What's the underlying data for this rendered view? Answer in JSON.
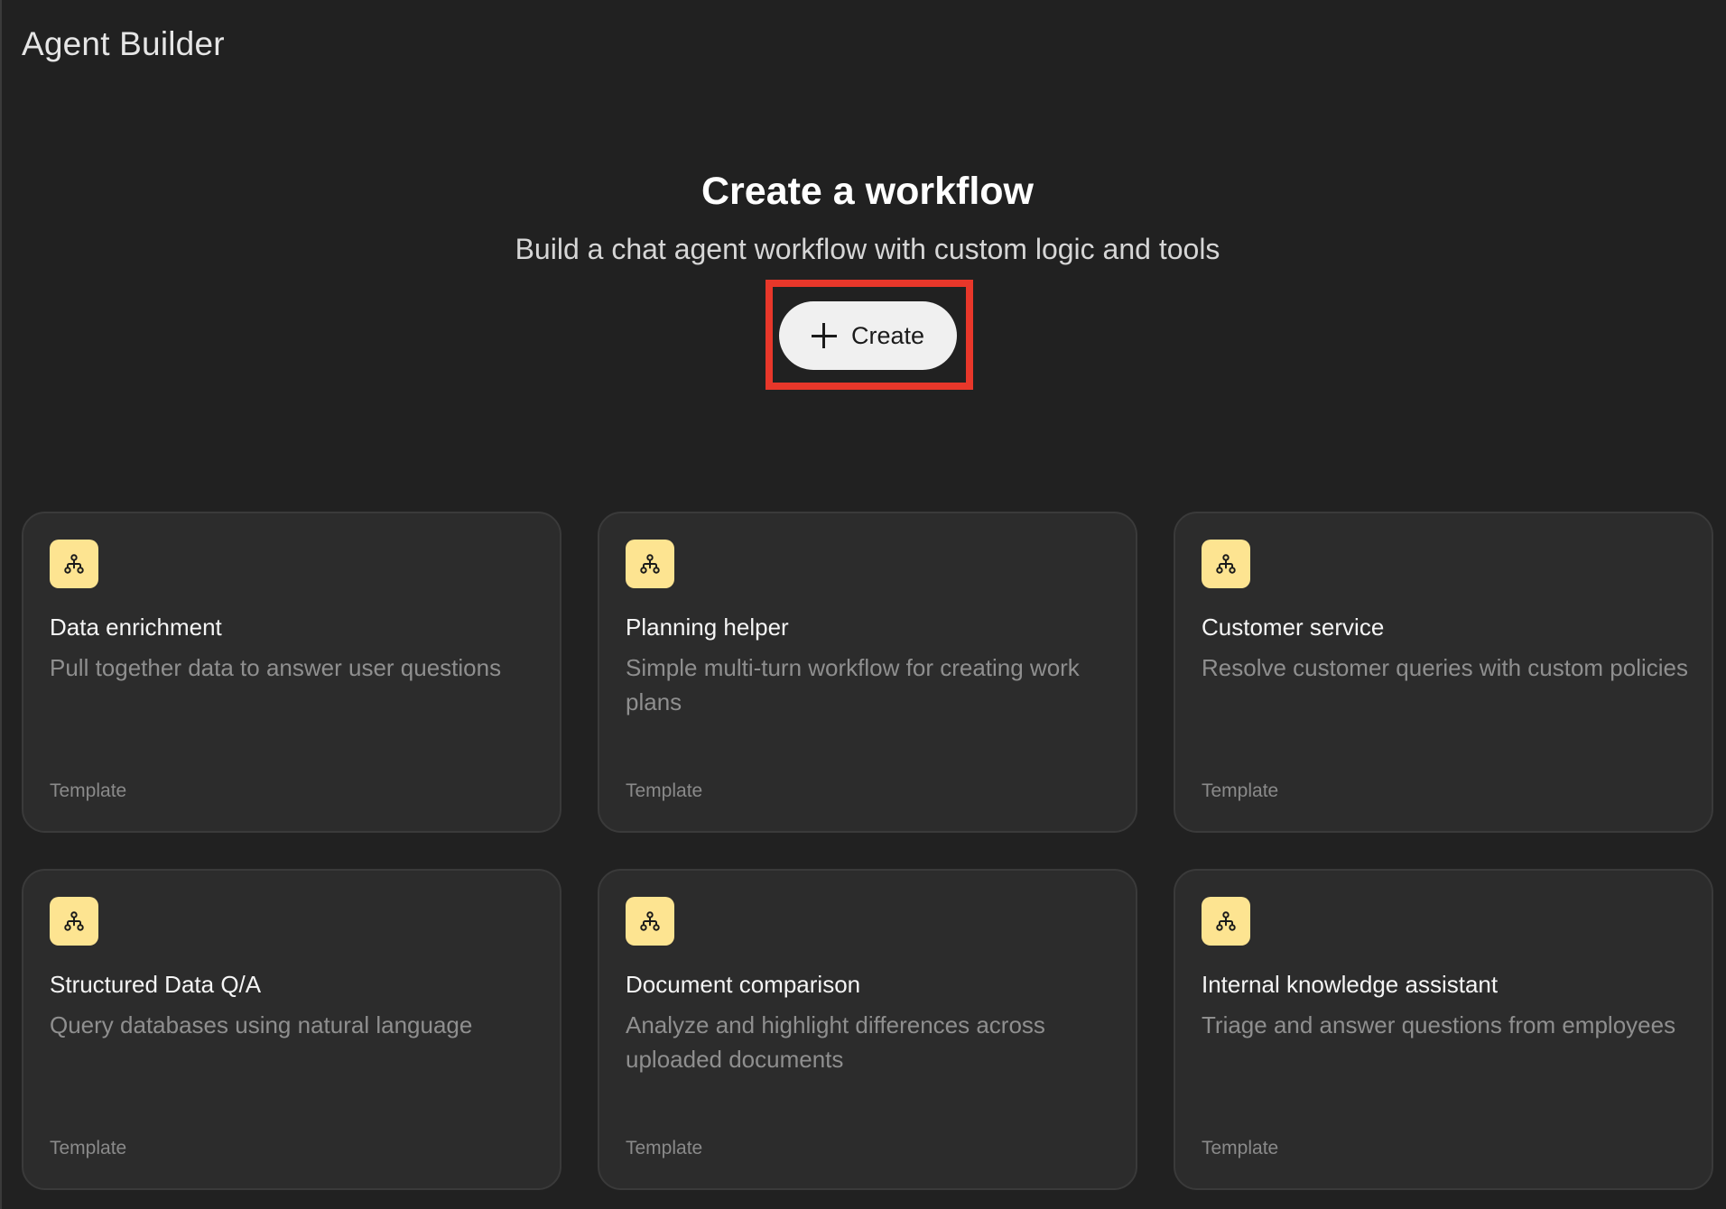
{
  "app": {
    "title": "Agent Builder"
  },
  "hero": {
    "title": "Create a workflow",
    "subtitle": "Build a chat agent workflow with custom logic and tools",
    "create_button_label": "Create"
  },
  "templates": [
    {
      "title": "Data enrichment",
      "description": "Pull together data to answer user questions",
      "tag": "Template",
      "icon": "workflow-icon"
    },
    {
      "title": "Planning helper",
      "description": "Simple multi-turn workflow for creating work plans",
      "tag": "Template",
      "icon": "workflow-icon"
    },
    {
      "title": "Customer service",
      "description": "Resolve customer queries with custom policies",
      "tag": "Template",
      "icon": "workflow-icon"
    },
    {
      "title": "Structured Data Q/A",
      "description": "Query databases using natural language",
      "tag": "Template",
      "icon": "workflow-icon"
    },
    {
      "title": "Document comparison",
      "description": "Analyze and highlight differences across uploaded documents",
      "tag": "Template",
      "icon": "workflow-icon"
    },
    {
      "title": "Internal knowledge assistant",
      "description": "Triage and answer questions from employees",
      "tag": "Template",
      "icon": "workflow-icon"
    }
  ],
  "colors": {
    "background": "#212121",
    "card_background": "#2c2c2c",
    "icon_badge": "#fde491",
    "highlight": "#e8372a"
  }
}
